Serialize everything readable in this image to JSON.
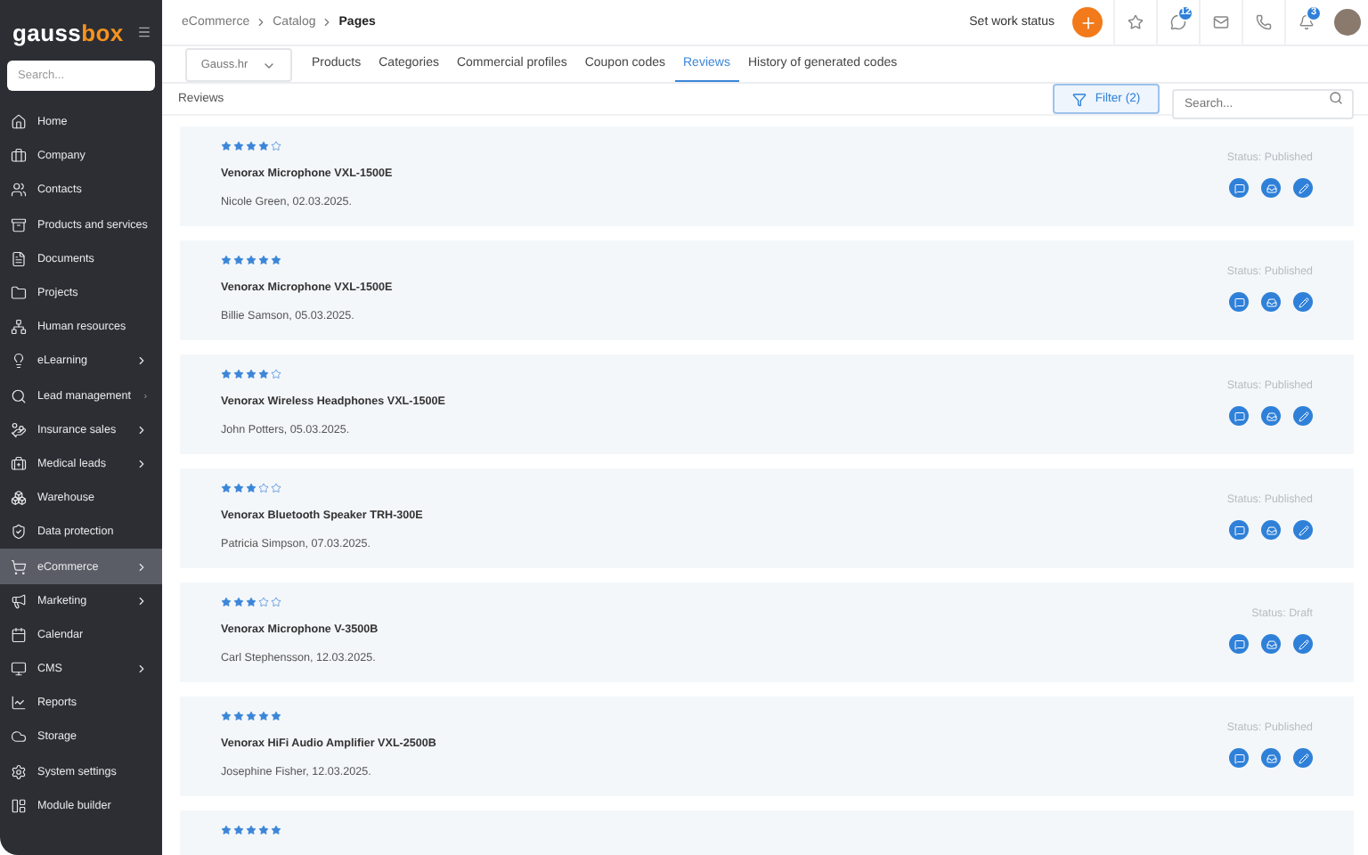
{
  "logo": {
    "first": "gauss",
    "second": "box"
  },
  "sidebar": {
    "search": {
      "placeholder": "Search..."
    },
    "items": [
      {
        "label": "Home",
        "expandable": false,
        "selected": false
      },
      {
        "label": "Company",
        "expandable": false,
        "selected": false
      },
      {
        "label": "Contacts",
        "expandable": false,
        "selected": false
      },
      {
        "label": "Products and services",
        "expandable": false,
        "selected": false
      },
      {
        "label": "Documents",
        "expandable": false,
        "selected": false
      },
      {
        "label": "Projects",
        "expandable": false,
        "selected": false
      },
      {
        "label": "Human resources",
        "expandable": false,
        "selected": false
      },
      {
        "label": "eLearning",
        "expandable": true,
        "selected": false
      },
      {
        "label": "Lead management",
        "expandable": true,
        "selected": false
      },
      {
        "label": "Insurance sales",
        "expandable": true,
        "selected": false
      },
      {
        "label": "Medical leads",
        "expandable": true,
        "selected": false
      },
      {
        "label": "Warehouse",
        "expandable": false,
        "selected": false
      },
      {
        "label": "Data protection",
        "expandable": false,
        "selected": false
      },
      {
        "label": "eCommerce",
        "expandable": true,
        "selected": true
      },
      {
        "label": "Marketing",
        "expandable": true,
        "selected": false
      },
      {
        "label": "Calendar",
        "expandable": false,
        "selected": false
      },
      {
        "label": "CMS",
        "expandable": true,
        "selected": false
      },
      {
        "label": "Reports",
        "expandable": false,
        "selected": false
      },
      {
        "label": "Storage",
        "expandable": false,
        "selected": false
      },
      {
        "label": "System settings",
        "expandable": false,
        "selected": false
      },
      {
        "label": "Module builder",
        "expandable": false,
        "selected": false
      }
    ]
  },
  "breadcrumb": [
    "eCommerce",
    "Catalog",
    "Pages"
  ],
  "header": {
    "work_status": "Set work status",
    "messages_badge": "12",
    "notifications_badge": "3"
  },
  "store_select": "Gauss.hr",
  "tabs": [
    {
      "label": "Products",
      "selected": false
    },
    {
      "label": "Categories",
      "selected": false
    },
    {
      "label": "Commercial profiles",
      "selected": false
    },
    {
      "label": "Coupon codes",
      "selected": false
    },
    {
      "label": "Reviews",
      "selected": true
    },
    {
      "label": "History of generated codes",
      "selected": false
    }
  ],
  "section_title": "Reviews",
  "filter_button": "Filter (2)",
  "search": {
    "placeholder": "Search..."
  },
  "reviews": [
    {
      "stars": 4,
      "product": "Venorax Microphone VXL-1500E",
      "author": "Nicole Green, 02.03.2025.",
      "status": "Status: Published"
    },
    {
      "stars": 5,
      "product": "Venorax Microphone VXL-1500E",
      "author": "Billie Samson, 05.03.2025.",
      "status": "Status: Published"
    },
    {
      "stars": 4,
      "product": "Venorax Wireless Headphones VXL-1500E",
      "author": "John Potters, 05.03.2025.",
      "status": "Status: Published"
    },
    {
      "stars": 3,
      "product": "Venorax Bluetooth Speaker TRH-300E",
      "author": "Patricia Simpson, 07.03.2025.",
      "status": "Status: Published"
    },
    {
      "stars": 3,
      "product": "Venorax Microphone V-3500B",
      "author": "Carl Stephensson, 12.03.2025.",
      "status": "Status: Draft"
    },
    {
      "stars": 5,
      "product": "Venorax HiFi Audio Amplifier VXL-2500B",
      "author": "Josephine Fisher, 12.03.2025.",
      "status": "Status: Published"
    },
    {
      "stars": 5
    }
  ]
}
